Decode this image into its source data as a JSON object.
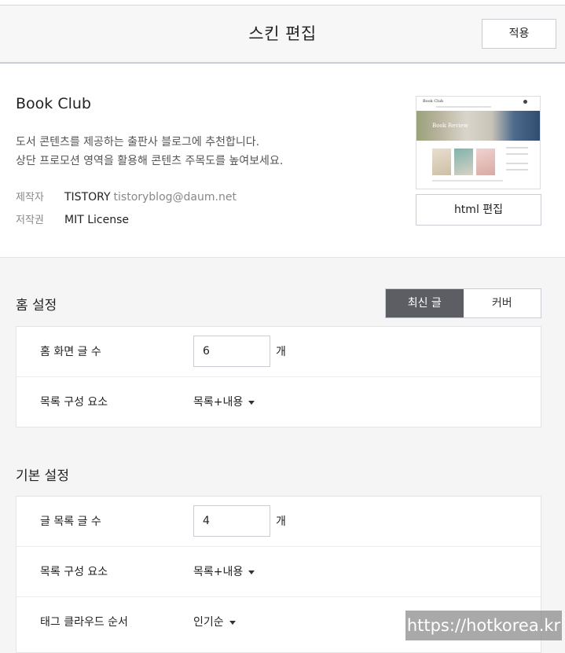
{
  "header": {
    "title": "스킨 편집",
    "apply_label": "적용"
  },
  "skin": {
    "name": "Book Club",
    "description_line1": "도서 콘텐츠를 제공하는 출판사 블로그에 추천합니다.",
    "description_line2": "상단 프로모션 영역을 활용해 콘텐츠 주목도를 높여보세요.",
    "author_label": "제작자",
    "author_name": "TISTORY",
    "author_email": "tistoryblog@daum.net",
    "license_label": "저작권",
    "license_value": "MIT License",
    "thumbnail": {
      "brand": "Book Club",
      "hero_text": "Book Review"
    },
    "html_edit_label": "html 편집"
  },
  "home_settings": {
    "title": "홈 설정",
    "tabs": [
      {
        "label": "최신 글",
        "active": true
      },
      {
        "label": "커버",
        "active": false
      }
    ],
    "rows": [
      {
        "label": "홈 화면 글 수",
        "value": "6",
        "unit": "개"
      },
      {
        "label": "목록 구성 요소",
        "select": "목록+내용"
      }
    ]
  },
  "basic_settings": {
    "title": "기본 설정",
    "rows": [
      {
        "label": "글 목록 글 수",
        "value": "4",
        "unit": "개"
      },
      {
        "label": "목록 구성 요소",
        "select": "목록+내용"
      },
      {
        "label": "태그 클라우드 순서",
        "select": "인기순"
      }
    ]
  },
  "watermark": "https://hotkorea.kr",
  "colors": {
    "active_tab": "#5c5e63",
    "background": "#f5f5f6",
    "header_border": "#c9ced6"
  }
}
